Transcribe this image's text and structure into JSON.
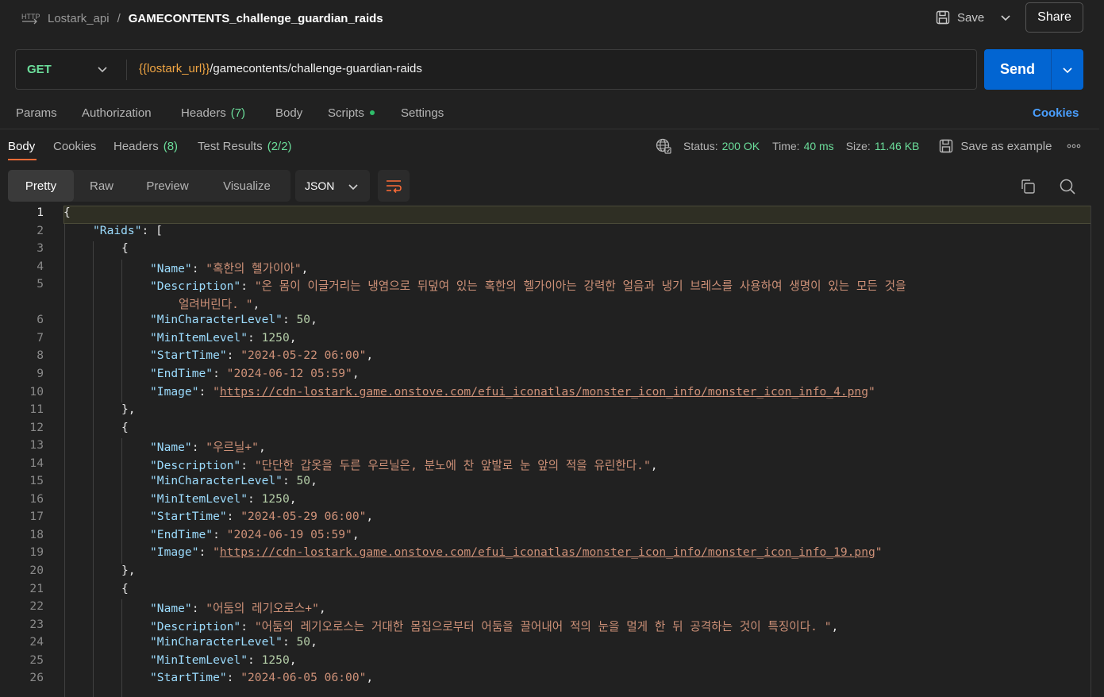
{
  "header": {
    "workspace": "Lostark_api",
    "separator": "/",
    "request_name": "GAMECONTENTS_challenge_guardian_raids",
    "save_label": "Save",
    "share_label": "Share"
  },
  "request": {
    "method": "GET",
    "url_var": "{{lostark_url}}",
    "url_path": "/gamecontents/challenge-guardian-raids",
    "send_label": "Send"
  },
  "request_tabs": {
    "params": "Params",
    "authorization": "Authorization",
    "headers": "Headers",
    "headers_count": "(7)",
    "body": "Body",
    "scripts": "Scripts",
    "settings": "Settings",
    "cookies": "Cookies"
  },
  "response_tabs": {
    "body": "Body",
    "cookies": "Cookies",
    "headers": "Headers",
    "headers_count": "(8)",
    "tests": "Test Results",
    "tests_count": "(2/2)"
  },
  "status": {
    "status_label": "Status:",
    "status_value": "200 OK",
    "time_label": "Time:",
    "time_value": "40 ms",
    "size_label": "Size:",
    "size_value": "11.46 KB",
    "save_example": "Save as example"
  },
  "view": {
    "pretty": "Pretty",
    "raw": "Raw",
    "preview": "Preview",
    "visualize": "Visualize",
    "format": "JSON"
  },
  "code": {
    "line_numbers": [
      "1",
      "2",
      "3",
      "4",
      "5",
      "",
      "6",
      "7",
      "8",
      "9",
      "10",
      "11",
      "12",
      "13",
      "14",
      "15",
      "16",
      "17",
      "18",
      "19",
      "20",
      "21",
      "22",
      "23",
      "24",
      "25",
      "26"
    ],
    "lines": [
      [
        [
          "p",
          "{"
        ]
      ],
      [
        [
          "k",
          "\"Raids\""
        ],
        [
          "p",
          ": ["
        ]
      ],
      [
        [
          "p",
          "{"
        ]
      ],
      [
        [
          "k",
          "\"Name\""
        ],
        [
          "p",
          ": "
        ],
        [
          "s",
          "\"혹한의 헬가이아\""
        ],
        [
          "p",
          ","
        ]
      ],
      [
        [
          "k",
          "\"Description\""
        ],
        [
          "p",
          ": "
        ],
        [
          "s",
          "\"온 몸이 이글거리는 냉염으로 뒤덮여 있는 혹한의 헬가이아는 강력한 얼음과 냉기 브레스를 사용하여 생명이 있는 모든 것을"
        ]
      ],
      [
        [
          "s",
          "얼려버린다. \""
        ],
        [
          "p",
          ","
        ]
      ],
      [
        [
          "k",
          "\"MinCharacterLevel\""
        ],
        [
          "p",
          ": "
        ],
        [
          "n",
          "50"
        ],
        [
          "p",
          ","
        ]
      ],
      [
        [
          "k",
          "\"MinItemLevel\""
        ],
        [
          "p",
          ": "
        ],
        [
          "n",
          "1250"
        ],
        [
          "p",
          ","
        ]
      ],
      [
        [
          "k",
          "\"StartTime\""
        ],
        [
          "p",
          ": "
        ],
        [
          "s",
          "\"2024-05-22 06:00\""
        ],
        [
          "p",
          ","
        ]
      ],
      [
        [
          "k",
          "\"EndTime\""
        ],
        [
          "p",
          ": "
        ],
        [
          "s",
          "\"2024-06-12 05:59\""
        ],
        [
          "p",
          ","
        ]
      ],
      [
        [
          "k",
          "\"Image\""
        ],
        [
          "p",
          ": "
        ],
        [
          "s",
          "\""
        ],
        [
          "u",
          "https://cdn-lostark.game.onstove.com/efui_iconatlas/monster_icon_info/monster_icon_info_4.png"
        ],
        [
          "s",
          "\""
        ]
      ],
      [
        [
          "p",
          "},"
        ]
      ],
      [
        [
          "p",
          "{"
        ]
      ],
      [
        [
          "k",
          "\"Name\""
        ],
        [
          "p",
          ": "
        ],
        [
          "s",
          "\"우르닐+\""
        ],
        [
          "p",
          ","
        ]
      ],
      [
        [
          "k",
          "\"Description\""
        ],
        [
          "p",
          ": "
        ],
        [
          "s",
          "\"단단한 갑옷을 두른 우르닐은, 분노에 찬 앞발로 눈 앞의 적을 유린한다.\""
        ],
        [
          "p",
          ","
        ]
      ],
      [
        [
          "k",
          "\"MinCharacterLevel\""
        ],
        [
          "p",
          ": "
        ],
        [
          "n",
          "50"
        ],
        [
          "p",
          ","
        ]
      ],
      [
        [
          "k",
          "\"MinItemLevel\""
        ],
        [
          "p",
          ": "
        ],
        [
          "n",
          "1250"
        ],
        [
          "p",
          ","
        ]
      ],
      [
        [
          "k",
          "\"StartTime\""
        ],
        [
          "p",
          ": "
        ],
        [
          "s",
          "\"2024-05-29 06:00\""
        ],
        [
          "p",
          ","
        ]
      ],
      [
        [
          "k",
          "\"EndTime\""
        ],
        [
          "p",
          ": "
        ],
        [
          "s",
          "\"2024-06-19 05:59\""
        ],
        [
          "p",
          ","
        ]
      ],
      [
        [
          "k",
          "\"Image\""
        ],
        [
          "p",
          ": "
        ],
        [
          "s",
          "\""
        ],
        [
          "u",
          "https://cdn-lostark.game.onstove.com/efui_iconatlas/monster_icon_info/monster_icon_info_19.png"
        ],
        [
          "s",
          "\""
        ]
      ],
      [
        [
          "p",
          "},"
        ]
      ],
      [
        [
          "p",
          "{"
        ]
      ],
      [
        [
          "k",
          "\"Name\""
        ],
        [
          "p",
          ": "
        ],
        [
          "s",
          "\"어둠의 레기오로스+\""
        ],
        [
          "p",
          ","
        ]
      ],
      [
        [
          "k",
          "\"Description\""
        ],
        [
          "p",
          ": "
        ],
        [
          "s",
          "\"어둠의 레기오로스는 거대한 몸집으로부터 어둠을 끌어내어 적의 눈을 멀게 한 뒤 공격하는 것이 특징이다. \""
        ],
        [
          "p",
          ","
        ]
      ],
      [
        [
          "k",
          "\"MinCharacterLevel\""
        ],
        [
          "p",
          ": "
        ],
        [
          "n",
          "50"
        ],
        [
          "p",
          ","
        ]
      ],
      [
        [
          "k",
          "\"MinItemLevel\""
        ],
        [
          "p",
          ": "
        ],
        [
          "n",
          "1250"
        ],
        [
          "p",
          ","
        ]
      ],
      [
        [
          "k",
          "\"StartTime\""
        ],
        [
          "p",
          ": "
        ],
        [
          "s",
          "\"2024-06-05 06:00\""
        ],
        [
          "p",
          ","
        ]
      ]
    ]
  }
}
